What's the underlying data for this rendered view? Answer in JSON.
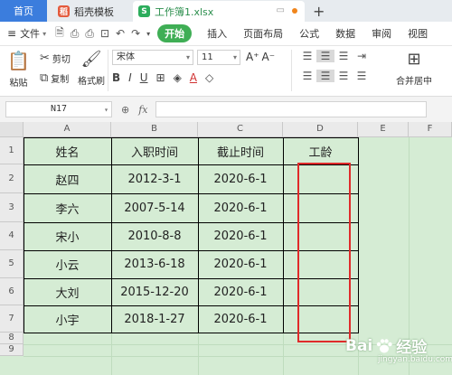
{
  "tabs": {
    "home": "首页",
    "template": "稻壳模板",
    "file": "工作簿1.xlsx"
  },
  "menu": {
    "file": "文件",
    "start": "开始",
    "items": [
      "插入",
      "页面布局",
      "公式",
      "数据",
      "审阅",
      "视图"
    ]
  },
  "ribbon": {
    "paste": "粘贴",
    "cut": "剪切",
    "copy": "复制",
    "format_painter": "格式刷",
    "font_name": "宋体",
    "font_size": "11",
    "merge_center": "合并居中"
  },
  "formula_bar": {
    "cell_ref": "N17",
    "fx": "fx"
  },
  "sheet": {
    "columns": [
      "A",
      "B",
      "C",
      "D",
      "E",
      "F"
    ],
    "rows": [
      "1",
      "2",
      "3",
      "4",
      "5",
      "6",
      "7",
      "8",
      "9"
    ],
    "headers": [
      "姓名",
      "入职时间",
      "截止时间",
      "工龄"
    ],
    "data": [
      [
        "赵四",
        "2012-3-1",
        "2020-6-1",
        ""
      ],
      [
        "李六",
        "2007-5-14",
        "2020-6-1",
        ""
      ],
      [
        "宋小",
        "2010-8-8",
        "2020-6-1",
        ""
      ],
      [
        "小云",
        "2013-6-18",
        "2020-6-1",
        ""
      ],
      [
        "大刘",
        "2015-12-20",
        "2020-6-1",
        ""
      ],
      [
        "小宇",
        "2018-1-27",
        "2020-6-1",
        ""
      ]
    ]
  },
  "watermark": {
    "brand_left": "Bai",
    "brand_right": "经验",
    "sub": "jingyan.baidu.com"
  },
  "colors": {
    "sheet_bg": "#d5ecd4",
    "tab_active": "#3b7ddd",
    "start_button": "#3fae55",
    "highlight_box": "#e02a2a"
  }
}
